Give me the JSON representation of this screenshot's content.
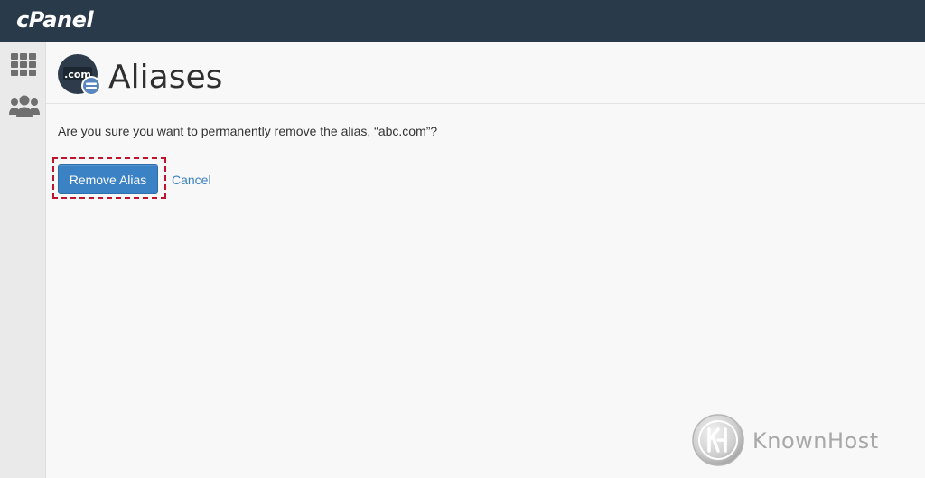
{
  "topbar": {
    "logo_text": "cPanel"
  },
  "sidebar": {
    "items": [
      {
        "icon": "grid-icon"
      },
      {
        "icon": "users-icon"
      }
    ]
  },
  "header": {
    "title": "Aliases",
    "icon_text": ".com"
  },
  "content": {
    "confirm_message": "Are you sure you want to permanently remove the alias, “abc.com”?",
    "remove_label": "Remove Alias",
    "cancel_label": "Cancel"
  },
  "watermark": {
    "brand": "KnownHost"
  },
  "colors": {
    "topbar": "#293a4a",
    "primary_button": "#3b82c4",
    "link": "#3b7fbf",
    "highlight": "#c0142d"
  }
}
